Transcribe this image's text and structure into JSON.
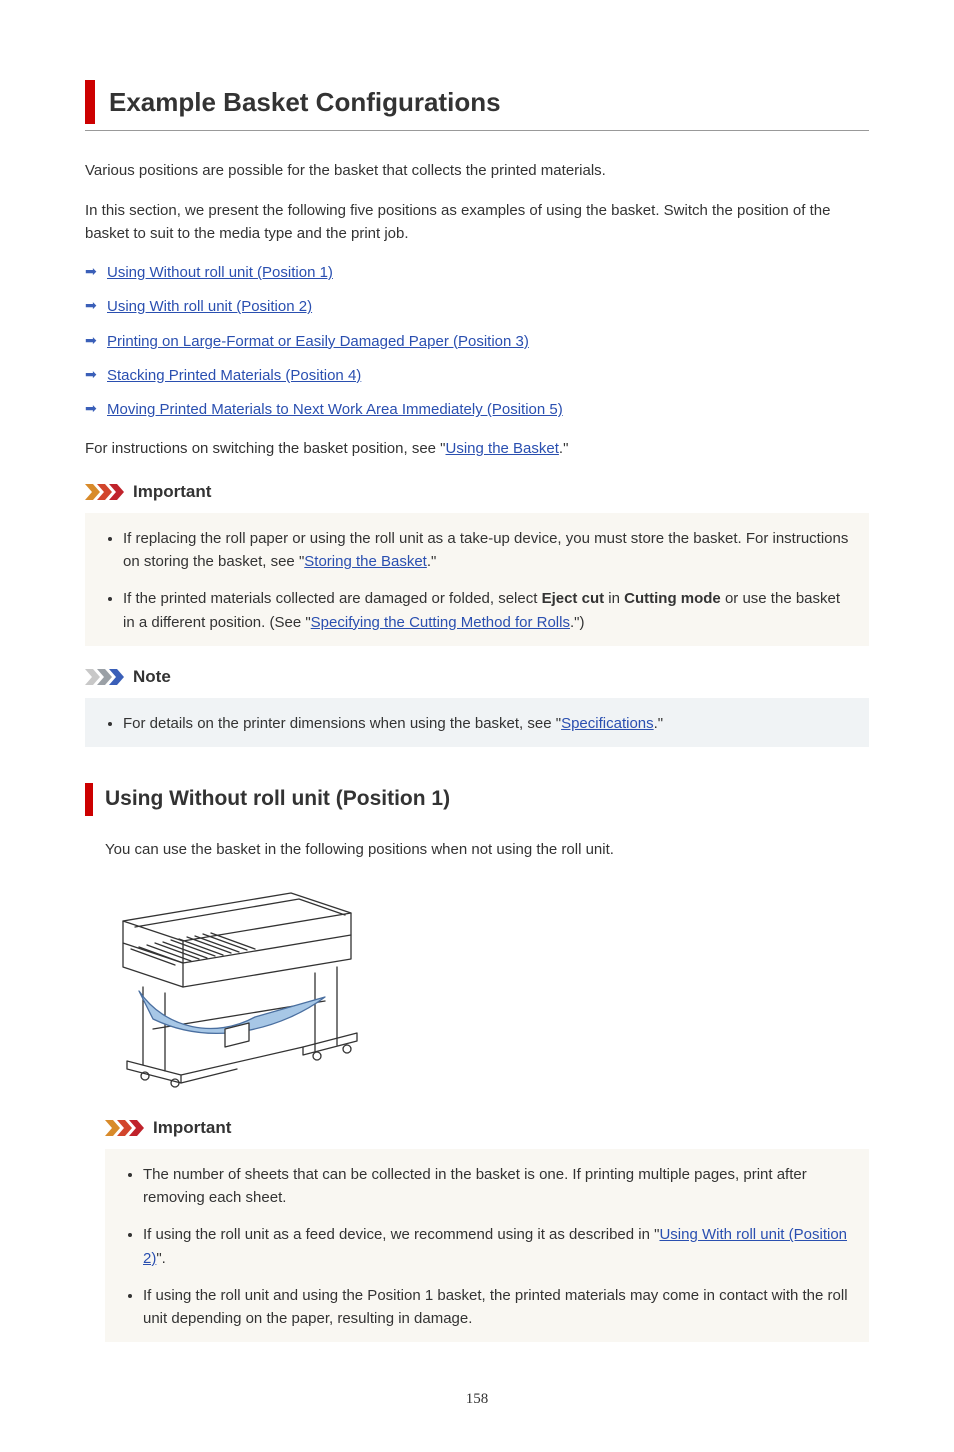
{
  "h1": "Example Basket Configurations",
  "intro1": "Various positions are possible for the basket that collects the printed materials.",
  "intro2": "In this section, we present the following five positions as examples of using the basket. Switch the position of the basket to suit to the media type and the print job.",
  "links": {
    "pos1": "Using Without roll unit (Position 1)",
    "pos2": "Using With roll unit (Position 2)",
    "pos3": "Printing on Large-Format or Easily Damaged Paper (Position 3)",
    "pos4": "Stacking Printed Materials (Position 4)",
    "pos5": "Moving Printed Materials to Next Work Area Immediately (Position 5)"
  },
  "instr_pre": "For instructions on switching the basket position, see \"",
  "instr_link": "Using the Basket",
  "instr_post": ".\"",
  "labels": {
    "important": "Important",
    "note": "Note"
  },
  "imp1": {
    "li1_pre": "If replacing the roll paper or using the roll unit as a take-up device, you must store the basket. For instructions on storing the basket, see \"",
    "li1_link": "Storing the Basket",
    "li1_post": ".\"",
    "li2_pre": "If the printed materials collected are damaged or folded, select ",
    "li2_b1": "Eject cut",
    "li2_mid": " in ",
    "li2_b2": "Cutting mode",
    "li2_mid2": " or use the basket in a different position. (See \"",
    "li2_link": "Specifying the Cutting Method for Rolls",
    "li2_post": ".\")"
  },
  "note1": {
    "pre": "For details on the printer dimensions when using the basket, see \"",
    "link": "Specifications",
    "post": ".\""
  },
  "h2": "Using Without roll unit (Position 1)",
  "h2_intro": "You can use the basket in the following positions when not using the roll unit.",
  "imp2": {
    "li1": "The number of sheets that can be collected in the basket is one. If printing multiple pages, print after removing each sheet.",
    "li2_pre": "If using the roll unit as a feed device, we recommend using it as described in \"",
    "li2_link": "Using With roll unit (Position 2)",
    "li2_post": "\".",
    "li3": "If using the roll unit and using the Position 1 basket, the printed materials may come in contact with the roll unit depending on the paper, resulting in damage."
  },
  "page": "158"
}
